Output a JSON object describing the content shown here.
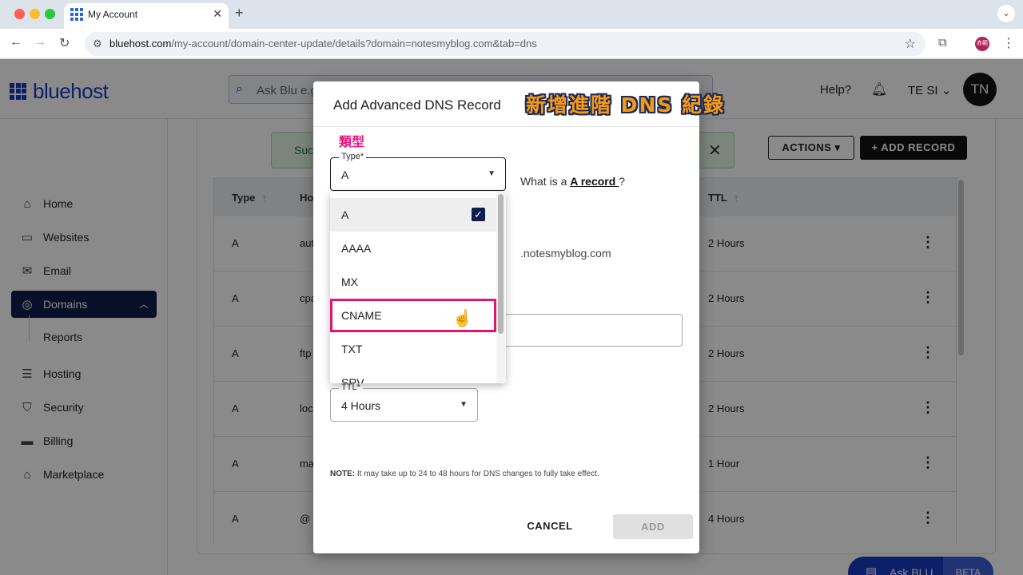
{
  "browser": {
    "tab_title": "My Account",
    "tab_close": "✕",
    "new_tab": "+",
    "tabs_menu": "⌄",
    "url_domain": "bluehost.com",
    "url_path": "/my-account/domain-center-update/details?domain=notesmyblog.com&tab=dns",
    "profile_text": "赤範"
  },
  "header": {
    "brand": "bluehost",
    "search_placeholder": "Ask Blu e.g.",
    "help": "Help?",
    "user_name": "TE SI",
    "avatar_initials": "TN"
  },
  "sidebar": {
    "items": [
      {
        "label": "Home",
        "icon": "⌂"
      },
      {
        "label": "Websites",
        "icon": "▭"
      },
      {
        "label": "Email",
        "icon": "✉"
      },
      {
        "label": "Domains",
        "icon": "◎"
      },
      {
        "label": "Hosting",
        "icon": "☰"
      },
      {
        "label": "Security",
        "icon": "⛉"
      },
      {
        "label": "Billing",
        "icon": "▬"
      },
      {
        "label": "Marketplace",
        "icon": "⌂"
      }
    ],
    "sub_reports": "Reports"
  },
  "main": {
    "success_text": "Suc",
    "actions_label": "ACTIONS ▾",
    "add_record_label": "+  ADD RECORD",
    "columns": {
      "type": "Type",
      "host": "Ho",
      "ttl": "TTL"
    },
    "rows": [
      {
        "type": "A",
        "host": "aut",
        "ttl": "2 Hours"
      },
      {
        "type": "A",
        "host": "cpa",
        "ttl": "2 Hours"
      },
      {
        "type": "A",
        "host": "ftp",
        "ttl": "2 Hours"
      },
      {
        "type": "A",
        "host": "loc",
        "ttl": "2 Hours"
      },
      {
        "type": "A",
        "host": "ma",
        "ttl": "1 Hour"
      },
      {
        "type": "A",
        "host": "@",
        "ttl": "4 Hours"
      }
    ],
    "ask_blu": "Ask BLU",
    "ask_blu_beta": "BETA"
  },
  "modal": {
    "title": "Add Advanced DNS Record",
    "callout_title": "新增進階 DNS 紀錄",
    "callout_type": "類型",
    "type_label": "Type*",
    "type_value": "A",
    "what_is_prefix": "What is a ",
    "what_is_link": "A record ",
    "what_is_suffix": "?",
    "domain_suffix": ".notesmyblog.com",
    "ttl_label": "TTL*",
    "ttl_value": "4 Hours",
    "note_bold": "NOTE:",
    "note_text": " It may take up to 24 to 48 hours for DNS changes to fully take effect.",
    "cancel": "CANCEL",
    "add": "ADD",
    "options": [
      "A",
      "AAAA",
      "MX",
      "CNAME",
      "TXT",
      "SRV"
    ]
  },
  "colors": {
    "brand": "#1a3ac4",
    "nav_active": "#0f1f4d",
    "highlight": "#e0156f",
    "callout": "#f59a16"
  }
}
